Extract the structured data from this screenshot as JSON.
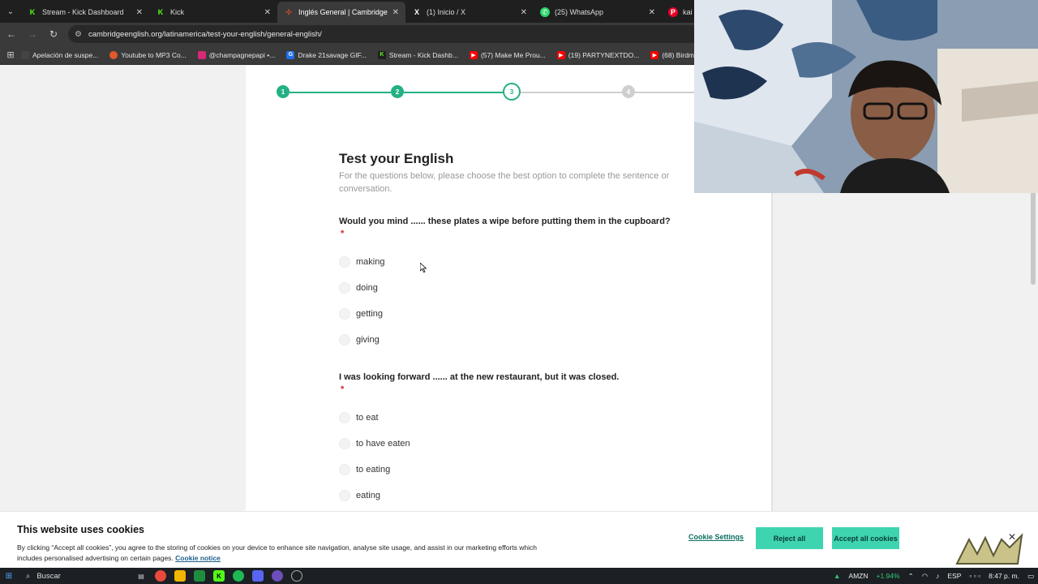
{
  "browser": {
    "tabs": [
      {
        "label": "Stream - Kick Dashboard",
        "icon": "kick-icon",
        "color": "#53fc18"
      },
      {
        "label": "Kick",
        "icon": "kick-icon",
        "color": "#53fc18"
      },
      {
        "label": "Inglés General | Cambridge En",
        "icon": "cambridge-icon",
        "color": "#e44d26"
      },
      {
        "label": "(1) Inicio / X",
        "icon": "x-icon",
        "color": "#ffffff"
      },
      {
        "label": "(25) WhatsApp",
        "icon": "whatsapp-icon",
        "color": "#25d366"
      },
      {
        "label": "kai c",
        "icon": "pinterest-icon",
        "color": "#e60023"
      }
    ],
    "url": "cambridgeenglish.org/latinamerica/test-your-english/general-english/",
    "bookmarks": [
      {
        "label": "Apelación de suspe...",
        "color": "#444444"
      },
      {
        "label": "Youtube to MP3 Co...",
        "color": "#e05a2b"
      },
      {
        "label": "@champagnepapi •...",
        "color": "#d62976"
      },
      {
        "label": "Drake 21savage GIF...",
        "color": "#1f6feb"
      },
      {
        "label": "Stream - Kick Dashb...",
        "color": "#53fc18"
      },
      {
        "label": "(57) Make Me Prou...",
        "color": "#ff0000"
      },
      {
        "label": "(19) PARTYNEXTDO...",
        "color": "#ff0000"
      },
      {
        "label": "(68) Birdman - Mon...",
        "color": "#ff0000"
      }
    ]
  },
  "stepper": {
    "steps": [
      "1",
      "2",
      "3",
      "4"
    ],
    "current": 3,
    "accent": "#23b084"
  },
  "test": {
    "title": "Test your English",
    "subtitle": "For the questions below, please choose the best option to complete the sentence or conversation.",
    "questions": [
      {
        "text": "Would you mind ...... these plates a wipe before putting them in the cupboard?",
        "required_mark": "*",
        "options": [
          "making",
          "doing",
          "getting",
          "giving"
        ]
      },
      {
        "text": "I was looking forward ...... at the new restaurant, but it was closed.",
        "required_mark": "*",
        "options": [
          "to eat",
          "to have eaten",
          "to eating",
          "eating"
        ]
      }
    ]
  },
  "cookie_banner": {
    "title": "This website uses cookies",
    "text": "By clicking “Accept all cookies”, you agree to the storing of cookies on your device to enhance site navigation, analyse site usage, and assist in our marketing efforts which includes personalised advertising on certain pages.",
    "link": "Cookie notice",
    "settings": "Cookie Settings",
    "reject": "Reject all",
    "accept": "Accept all cookies",
    "button_color": "#3fd4b0"
  },
  "taskbar": {
    "search": "Buscar",
    "stock_ticker": "AMZN",
    "stock_change": "+1.94%",
    "language": "ESP",
    "time": "8:47 p. m."
  }
}
